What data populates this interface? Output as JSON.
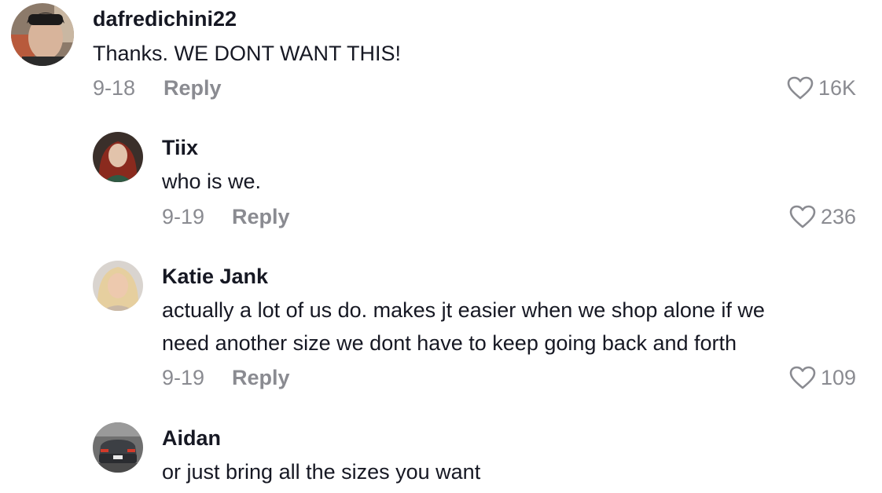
{
  "comments": [
    {
      "username": "dafredichini22",
      "text": [
        "Thanks. WE DONT WANT THIS!"
      ],
      "date": "9-18",
      "reply_label": "Reply",
      "like_count": "16K",
      "like_icon": "heart-outline-icon"
    },
    {
      "username": "Tiix",
      "text": [
        "who is we."
      ],
      "date": "9-19",
      "reply_label": "Reply",
      "like_count": "236",
      "like_icon": "heart-outline-icon"
    },
    {
      "username": "Katie Jank",
      "text": [
        "actually a lot of us do. makes jt easier when we shop alone if we",
        "need another size we dont have to keep going back and forth"
      ],
      "date": "9-19",
      "reply_label": "Reply",
      "like_count": "109",
      "like_icon": "heart-outline-icon"
    },
    {
      "username": "Aidan",
      "text": [
        "or just bring all the sizes you want"
      ]
    }
  ],
  "colors": {
    "text": "#161823",
    "muted": "#8a8b91",
    "background": "#ffffff"
  }
}
